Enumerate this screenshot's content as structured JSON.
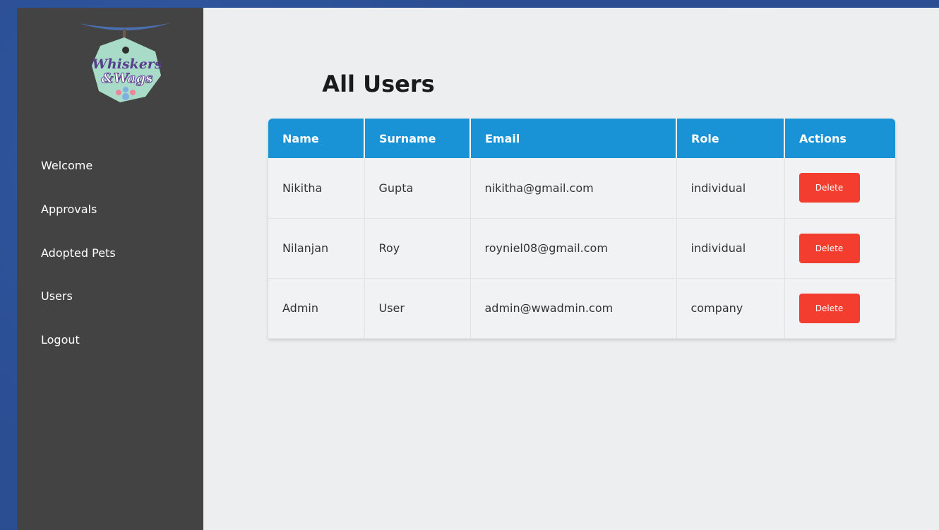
{
  "brand": {
    "logo_line1": "Whiskers",
    "logo_line2": "&Wags"
  },
  "sidebar": {
    "items": [
      {
        "label": "Welcome"
      },
      {
        "label": "Approvals"
      },
      {
        "label": "Adopted Pets"
      },
      {
        "label": "Users"
      },
      {
        "label": "Logout"
      }
    ]
  },
  "main": {
    "title": "All Users",
    "table": {
      "headers": [
        "Name",
        "Surname",
        "Email",
        "Role",
        "Actions"
      ],
      "rows": [
        {
          "name": "Nikitha",
          "surname": "Gupta",
          "email": "nikitha@gmail.com",
          "role": "individual",
          "action": "Delete"
        },
        {
          "name": "Nilanjan",
          "surname": "Roy",
          "email": "royniel08@gmail.com",
          "role": "individual",
          "action": "Delete"
        },
        {
          "name": "Admin",
          "surname": "User",
          "email": "admin@wwadmin.com",
          "role": "company",
          "action": "Delete"
        }
      ]
    }
  },
  "colors": {
    "sidebar_bg": "#434343",
    "header_bg": "#1a92d6",
    "delete_button": "#f23d2f",
    "main_bg": "#eceef0"
  }
}
